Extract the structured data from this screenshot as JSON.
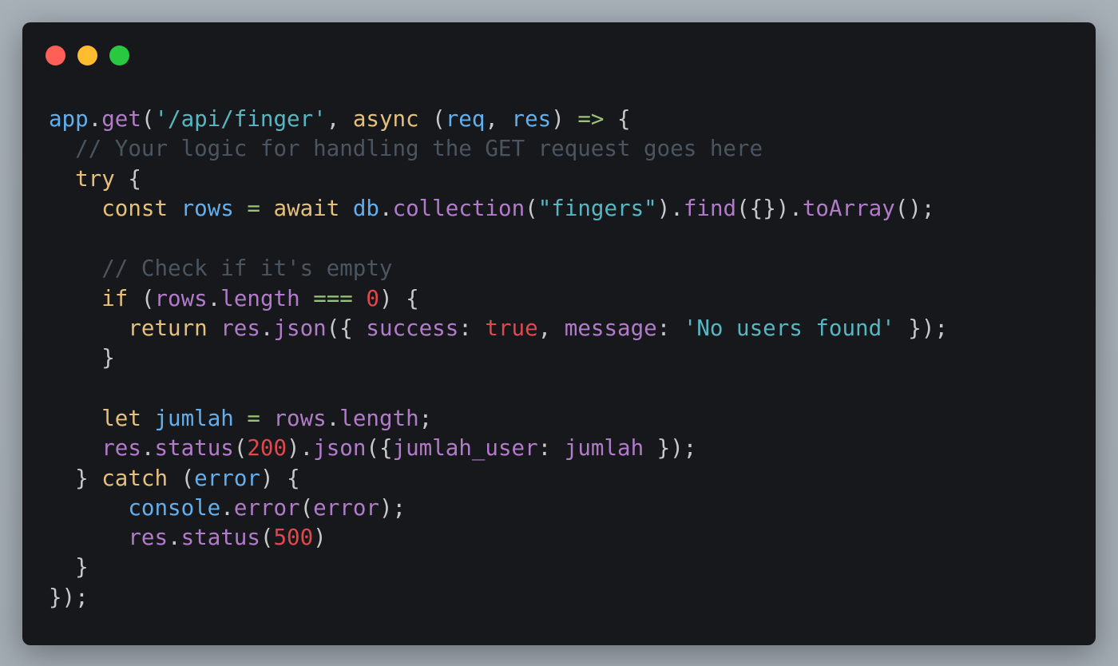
{
  "window": {
    "controls": {
      "close_color": "#fe5f57",
      "minimize_color": "#febc2e",
      "maximize_color": "#28c840"
    }
  },
  "code": {
    "language": "javascript",
    "lines": [
      {
        "tokens": [
          {
            "text": "app",
            "type": "obj"
          },
          {
            "text": ".",
            "type": "default"
          },
          {
            "text": "get",
            "type": "method"
          },
          {
            "text": "(",
            "type": "default"
          },
          {
            "text": "'/api/finger'",
            "type": "string"
          },
          {
            "text": ", ",
            "type": "default"
          },
          {
            "text": "async",
            "type": "keyword"
          },
          {
            "text": " (",
            "type": "default"
          },
          {
            "text": "req",
            "type": "param"
          },
          {
            "text": ", ",
            "type": "default"
          },
          {
            "text": "res",
            "type": "param"
          },
          {
            "text": ") ",
            "type": "default"
          },
          {
            "text": "=>",
            "type": "arrow"
          },
          {
            "text": " {",
            "type": "default"
          }
        ]
      },
      {
        "tokens": [
          {
            "text": "  // Your logic for handling the GET request goes here",
            "type": "comment"
          }
        ]
      },
      {
        "tokens": [
          {
            "text": "  ",
            "type": "default"
          },
          {
            "text": "try",
            "type": "keyword"
          },
          {
            "text": " {",
            "type": "default"
          }
        ]
      },
      {
        "tokens": [
          {
            "text": "    ",
            "type": "default"
          },
          {
            "text": "const",
            "type": "keyword"
          },
          {
            "text": " ",
            "type": "default"
          },
          {
            "text": "rows",
            "type": "obj"
          },
          {
            "text": " ",
            "type": "default"
          },
          {
            "text": "=",
            "type": "op"
          },
          {
            "text": " ",
            "type": "default"
          },
          {
            "text": "await",
            "type": "keyword"
          },
          {
            "text": " ",
            "type": "default"
          },
          {
            "text": "db",
            "type": "obj"
          },
          {
            "text": ".",
            "type": "default"
          },
          {
            "text": "collection",
            "type": "method"
          },
          {
            "text": "(",
            "type": "default"
          },
          {
            "text": "\"fingers\"",
            "type": "string"
          },
          {
            "text": ").",
            "type": "default"
          },
          {
            "text": "find",
            "type": "method"
          },
          {
            "text": "({}).",
            "type": "default"
          },
          {
            "text": "toArray",
            "type": "method"
          },
          {
            "text": "();",
            "type": "default"
          }
        ]
      },
      {
        "gap": true,
        "tokens": []
      },
      {
        "tokens": [
          {
            "text": "    // Check if it's empty",
            "type": "comment"
          }
        ]
      },
      {
        "tokens": [
          {
            "text": "    ",
            "type": "default"
          },
          {
            "text": "if",
            "type": "keyword"
          },
          {
            "text": " (",
            "type": "default"
          },
          {
            "text": "rows",
            "type": "prop"
          },
          {
            "text": ".",
            "type": "default"
          },
          {
            "text": "length",
            "type": "prop"
          },
          {
            "text": " ",
            "type": "default"
          },
          {
            "text": "===",
            "type": "op"
          },
          {
            "text": " ",
            "type": "default"
          },
          {
            "text": "0",
            "type": "number"
          },
          {
            "text": ") {",
            "type": "default"
          }
        ]
      },
      {
        "tokens": [
          {
            "text": "      ",
            "type": "default"
          },
          {
            "text": "return",
            "type": "keyword"
          },
          {
            "text": " ",
            "type": "default"
          },
          {
            "text": "res",
            "type": "prop"
          },
          {
            "text": ".",
            "type": "default"
          },
          {
            "text": "json",
            "type": "method"
          },
          {
            "text": "({ ",
            "type": "default"
          },
          {
            "text": "success",
            "type": "prop"
          },
          {
            "text": ": ",
            "type": "default"
          },
          {
            "text": "true",
            "type": "bool"
          },
          {
            "text": ", ",
            "type": "default"
          },
          {
            "text": "message",
            "type": "prop"
          },
          {
            "text": ": ",
            "type": "default"
          },
          {
            "text": "'No users found'",
            "type": "string"
          },
          {
            "text": " });",
            "type": "default"
          }
        ]
      },
      {
        "tokens": [
          {
            "text": "    }",
            "type": "default"
          }
        ]
      },
      {
        "gap": true,
        "tokens": []
      },
      {
        "tokens": [
          {
            "text": "    ",
            "type": "default"
          },
          {
            "text": "let",
            "type": "keyword"
          },
          {
            "text": " ",
            "type": "default"
          },
          {
            "text": "jumlah",
            "type": "obj"
          },
          {
            "text": " ",
            "type": "default"
          },
          {
            "text": "=",
            "type": "op"
          },
          {
            "text": " ",
            "type": "default"
          },
          {
            "text": "rows",
            "type": "prop"
          },
          {
            "text": ".",
            "type": "default"
          },
          {
            "text": "length",
            "type": "prop"
          },
          {
            "text": ";",
            "type": "default"
          }
        ]
      },
      {
        "tokens": [
          {
            "text": "    ",
            "type": "default"
          },
          {
            "text": "res",
            "type": "prop"
          },
          {
            "text": ".",
            "type": "default"
          },
          {
            "text": "status",
            "type": "method"
          },
          {
            "text": "(",
            "type": "default"
          },
          {
            "text": "200",
            "type": "number"
          },
          {
            "text": ").",
            "type": "default"
          },
          {
            "text": "json",
            "type": "method"
          },
          {
            "text": "({",
            "type": "default"
          },
          {
            "text": "jumlah_user",
            "type": "prop"
          },
          {
            "text": ": ",
            "type": "default"
          },
          {
            "text": "jumlah",
            "type": "prop"
          },
          {
            "text": " });",
            "type": "default"
          }
        ]
      },
      {
        "tokens": [
          {
            "text": "  } ",
            "type": "default"
          },
          {
            "text": "catch",
            "type": "keyword"
          },
          {
            "text": " (",
            "type": "default"
          },
          {
            "text": "error",
            "type": "obj"
          },
          {
            "text": ") {",
            "type": "default"
          }
        ]
      },
      {
        "tokens": [
          {
            "text": "      ",
            "type": "default"
          },
          {
            "text": "console",
            "type": "obj"
          },
          {
            "text": ".",
            "type": "default"
          },
          {
            "text": "error",
            "type": "method"
          },
          {
            "text": "(",
            "type": "default"
          },
          {
            "text": "error",
            "type": "prop"
          },
          {
            "text": ");",
            "type": "default"
          }
        ]
      },
      {
        "tokens": [
          {
            "text": "      ",
            "type": "default"
          },
          {
            "text": "res",
            "type": "prop"
          },
          {
            "text": ".",
            "type": "default"
          },
          {
            "text": "status",
            "type": "method"
          },
          {
            "text": "(",
            "type": "default"
          },
          {
            "text": "500",
            "type": "number"
          },
          {
            "text": ")",
            "type": "default"
          }
        ]
      },
      {
        "tokens": [
          {
            "text": "  }",
            "type": "default"
          }
        ]
      },
      {
        "tokens": [
          {
            "text": "});",
            "type": "default"
          }
        ]
      }
    ]
  }
}
